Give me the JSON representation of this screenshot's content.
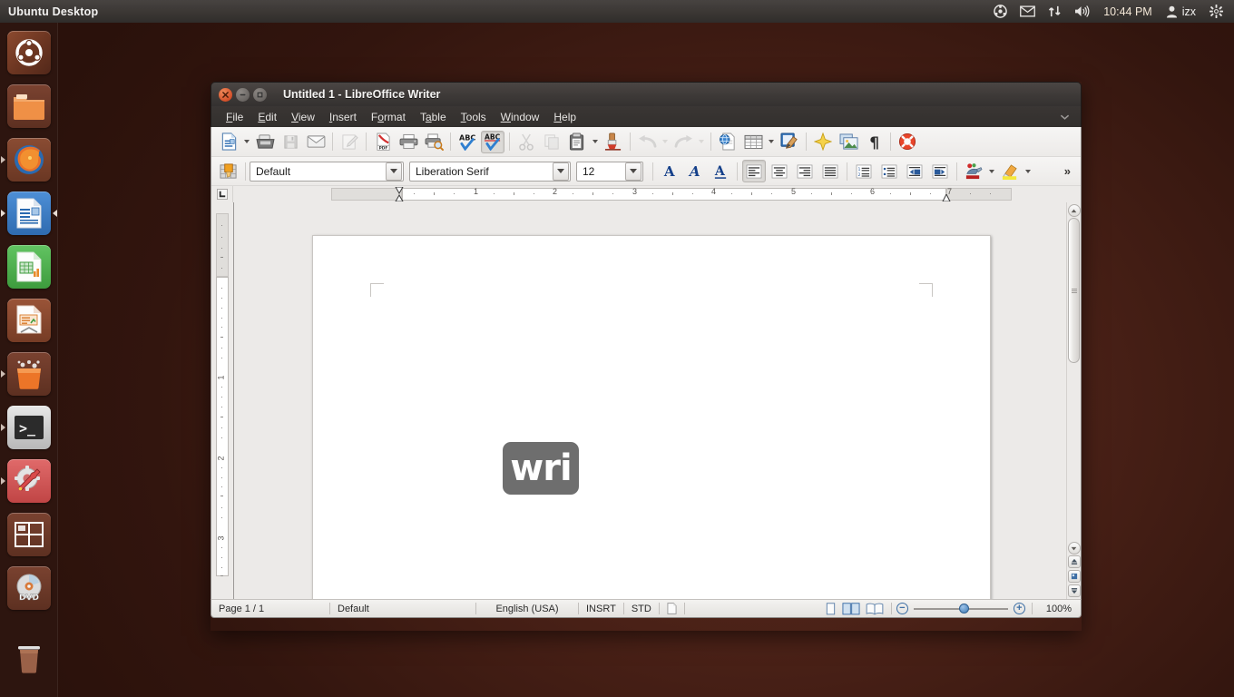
{
  "desktop": {
    "panel_title": "Ubuntu Desktop",
    "indicators": [
      {
        "name": "ubuntuone-icon",
        "label": ""
      },
      {
        "name": "messaging-envelope-icon",
        "label": ""
      },
      {
        "name": "network-updown-icon",
        "label": ""
      },
      {
        "name": "volume-icon",
        "label": ""
      }
    ],
    "clock": "10:44 PM",
    "user": "izx",
    "session_icon": "gear-icon"
  },
  "launcher": {
    "items": [
      {
        "name": "dash-home",
        "label": "Ubuntu Dash Home",
        "icon": "ubuntu-logo-icon",
        "running": false,
        "focused": false
      },
      {
        "name": "files",
        "label": "Files",
        "icon": "folder-icon",
        "running": false,
        "focused": false
      },
      {
        "name": "firefox",
        "label": "Firefox Web Browser",
        "icon": "firefox-icon",
        "running": false,
        "focused": false
      },
      {
        "name": "libreoffice-writer",
        "label": "LibreOffice Writer",
        "icon": "writer-icon",
        "running": true,
        "focused": true
      },
      {
        "name": "libreoffice-calc",
        "label": "LibreOffice Calc",
        "icon": "calc-icon",
        "running": false,
        "focused": false
      },
      {
        "name": "libreoffice-impress",
        "label": "LibreOffice Impress",
        "icon": "impress-icon",
        "running": false,
        "focused": false
      },
      {
        "name": "software-center",
        "label": "Ubuntu Software Center",
        "icon": "software-bag-icon",
        "running": false,
        "focused": false
      },
      {
        "name": "terminal",
        "label": "Terminal",
        "icon": "terminal-icon",
        "running": true,
        "focused": false
      },
      {
        "name": "system-settings",
        "label": "System Settings",
        "icon": "gear-wrench-icon",
        "running": true,
        "focused": false
      },
      {
        "name": "workspace-switcher",
        "label": "Workspace Switcher",
        "icon": "workspaces-icon",
        "running": false,
        "focused": false
      },
      {
        "name": "disc-drive",
        "label": "DVD Drive",
        "icon": "dvd-icon",
        "running": false,
        "focused": false
      },
      {
        "name": "trash",
        "label": "Trash",
        "icon": "trash-icon",
        "running": false,
        "focused": false
      }
    ]
  },
  "window": {
    "title": "Untitled 1 - LibreOffice Writer",
    "controls": {
      "close": "close-icon",
      "minimize": "minimize-icon",
      "maximize": "maximize-icon"
    },
    "menus": [
      {
        "label": "File",
        "accel": "F"
      },
      {
        "label": "Edit",
        "accel": "E"
      },
      {
        "label": "View",
        "accel": "V"
      },
      {
        "label": "Insert",
        "accel": "I"
      },
      {
        "label": "Format",
        "accel": "o"
      },
      {
        "label": "Table",
        "accel": "a"
      },
      {
        "label": "Tools",
        "accel": "T"
      },
      {
        "label": "Window",
        "accel": "W"
      },
      {
        "label": "Help",
        "accel": "H"
      }
    ],
    "menubar_overflow": "⌄"
  },
  "standard_toolbar": {
    "buttons": [
      {
        "name": "new-document-button",
        "title": "New",
        "icon": "new-doc-icon",
        "dropdown": true,
        "enabled": true,
        "active": false
      },
      {
        "name": "open-button",
        "title": "Open",
        "icon": "open-folder-icon",
        "dropdown": false,
        "enabled": true,
        "active": false
      },
      {
        "name": "save-button",
        "title": "Save",
        "icon": "save-disk-icon",
        "dropdown": false,
        "enabled": false,
        "active": false
      },
      {
        "name": "email-button",
        "title": "E-mail Document",
        "icon": "envelope-icon",
        "dropdown": false,
        "enabled": true,
        "active": false
      },
      {
        "name": "edit-mode-button",
        "title": "Edit Mode",
        "icon": "pencil-page-icon",
        "dropdown": false,
        "enabled": false,
        "active": false
      },
      {
        "name": "export-pdf-button",
        "title": "Export as PDF",
        "icon": "pdf-icon",
        "dropdown": false,
        "enabled": true,
        "active": false
      },
      {
        "name": "print-button",
        "title": "Print",
        "icon": "printer-icon",
        "dropdown": false,
        "enabled": true,
        "active": false
      },
      {
        "name": "print-preview-button",
        "title": "Print Preview",
        "icon": "print-preview-icon",
        "dropdown": false,
        "enabled": true,
        "active": false
      },
      {
        "name": "spelling-button",
        "title": "Spelling and Grammar",
        "icon": "abc-check-icon",
        "dropdown": false,
        "enabled": true,
        "active": false
      },
      {
        "name": "autospellcheck-button",
        "title": "AutoSpellcheck",
        "icon": "abc-auto-icon",
        "dropdown": false,
        "enabled": true,
        "active": true
      },
      {
        "name": "cut-button",
        "title": "Cut",
        "icon": "scissors-icon",
        "dropdown": false,
        "enabled": false,
        "active": false
      },
      {
        "name": "copy-button",
        "title": "Copy",
        "icon": "copy-icon",
        "dropdown": false,
        "enabled": false,
        "active": false
      },
      {
        "name": "paste-button",
        "title": "Paste",
        "icon": "clipboard-icon",
        "dropdown": true,
        "enabled": true,
        "active": false
      },
      {
        "name": "clone-formatting-button",
        "title": "Clone Formatting",
        "icon": "paintbrush-icon",
        "dropdown": false,
        "enabled": true,
        "active": false
      },
      {
        "name": "undo-button",
        "title": "Undo",
        "icon": "undo-arrow-icon",
        "dropdown": true,
        "enabled": false,
        "active": false
      },
      {
        "name": "redo-button",
        "title": "Redo",
        "icon": "redo-arrow-icon",
        "dropdown": true,
        "enabled": false,
        "active": false
      },
      {
        "name": "hyperlink-button",
        "title": "Insert Hyperlink",
        "icon": "globe-page-icon",
        "dropdown": false,
        "enabled": true,
        "active": false
      },
      {
        "name": "insert-table-button",
        "title": "Insert Table",
        "icon": "table-grid-icon",
        "dropdown": true,
        "enabled": true,
        "active": false
      },
      {
        "name": "draw-functions-button",
        "title": "Show Draw Functions",
        "icon": "draw-brush-icon",
        "dropdown": false,
        "enabled": true,
        "active": false
      },
      {
        "name": "gallery-button",
        "title": "Gallery",
        "icon": "star-gallery-icon",
        "dropdown": false,
        "enabled": true,
        "active": false
      },
      {
        "name": "image-button",
        "title": "Insert Image",
        "icon": "picture-stack-icon",
        "dropdown": false,
        "enabled": true,
        "active": false
      },
      {
        "name": "formatting-marks-button",
        "title": "Formatting Marks",
        "icon": "pilcrow-icon",
        "dropdown": false,
        "enabled": true,
        "active": false
      },
      {
        "name": "help-button",
        "title": "LibreOffice Help",
        "icon": "lifebuoy-icon",
        "dropdown": false,
        "enabled": true,
        "active": false
      }
    ]
  },
  "format_toolbar": {
    "paragraph_style_icon": "paragraph-style-icon",
    "paragraph_style": "Default",
    "font_name": "Liberation Serif",
    "font_size": "12",
    "buttons": [
      {
        "name": "bold-button",
        "title": "Bold",
        "glyph": "A",
        "style": "bold",
        "active": false
      },
      {
        "name": "italic-button",
        "title": "Italic",
        "glyph": "A",
        "style": "italic",
        "active": false
      },
      {
        "name": "underline-button",
        "title": "Underline",
        "glyph": "A",
        "style": "underline",
        "active": false
      },
      {
        "name": "align-left-button",
        "title": "Align Left",
        "icon": "align-left-icon",
        "active": true
      },
      {
        "name": "align-center-button",
        "title": "Center",
        "icon": "align-center-icon",
        "active": false
      },
      {
        "name": "align-right-button",
        "title": "Align Right",
        "icon": "align-right-icon",
        "active": false
      },
      {
        "name": "justify-button",
        "title": "Justified",
        "icon": "align-justify-icon",
        "active": false
      },
      {
        "name": "ordered-list-button",
        "title": "Ordered List",
        "icon": "numbered-list-icon",
        "active": false
      },
      {
        "name": "unordered-list-button",
        "title": "Unordered List",
        "icon": "bullet-list-icon",
        "active": false
      },
      {
        "name": "decrease-indent-button",
        "title": "Decrease Indent",
        "icon": "decrease-indent-icon",
        "active": false
      },
      {
        "name": "increase-indent-button",
        "title": "Increase Indent",
        "icon": "increase-indent-icon",
        "active": false
      },
      {
        "name": "font-color-button",
        "title": "Font Color",
        "icon": "font-color-icon",
        "dropdown": true,
        "active": false
      },
      {
        "name": "highlight-color-button",
        "title": "Highlighting Color",
        "icon": "highlight-color-icon",
        "dropdown": true,
        "active": false
      }
    ],
    "overflow": "»"
  },
  "ruler": {
    "horizontal_numbers": [
      "1",
      "2",
      "3",
      "4",
      "5",
      "6",
      "7"
    ],
    "vertical_numbers": [
      "1",
      "2",
      "3"
    ],
    "units": "inch"
  },
  "document": {
    "overlay_badge": "wri",
    "overlay_badge_color": "#6e6e6e"
  },
  "statusbar": {
    "page": "Page 1 / 1",
    "page_style": "Default",
    "language": "English (USA)",
    "insert_mode": "INSRT",
    "selection_mode": "STD",
    "modified_icon": "unsaved-doc-icon",
    "view_buttons": [
      {
        "name": "single-page-view-button",
        "title": "Single-page view",
        "active": false
      },
      {
        "name": "multi-page-view-button",
        "title": "Multiple-page view",
        "active": true
      },
      {
        "name": "book-view-button",
        "title": "Book view",
        "active": false
      }
    ],
    "zoom_out": "−",
    "zoom_in": "+",
    "zoom_level": "100%"
  }
}
